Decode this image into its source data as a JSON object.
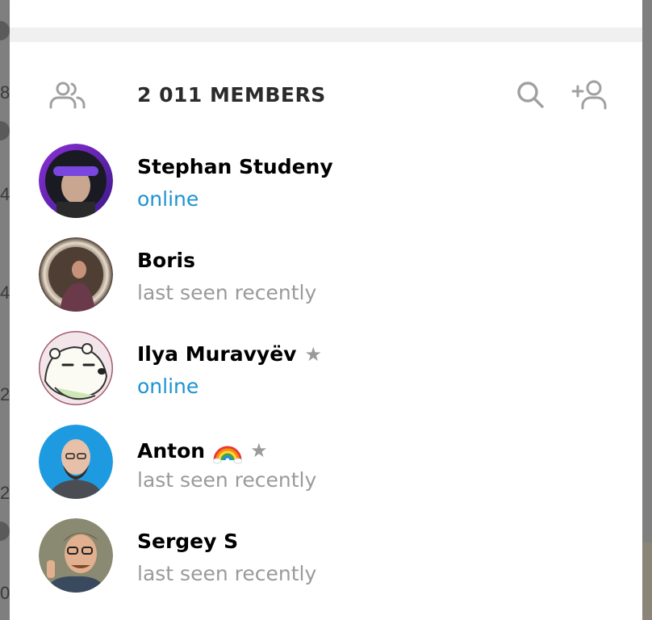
{
  "background": {
    "fragments": [
      "8",
      "4",
      "4",
      "2",
      "2",
      "0"
    ]
  },
  "header": {
    "members_count": "2 011 MEMBERS",
    "left_icon": "group-icon",
    "search_icon": "search-icon",
    "add_icon": "add-member-icon"
  },
  "members": [
    {
      "name": "Stephan Studeny",
      "status": "online",
      "online": true,
      "admin": false,
      "emoji": ""
    },
    {
      "name": "Boris",
      "status": "last seen recently",
      "online": false,
      "admin": false,
      "emoji": ""
    },
    {
      "name": "Ilya Muravyëv",
      "status": "online",
      "online": true,
      "admin": true,
      "emoji": ""
    },
    {
      "name": "Anton",
      "status": "last seen recently",
      "online": false,
      "admin": true,
      "emoji": "rainbow"
    },
    {
      "name": "Sergey S",
      "status": "last seen recently",
      "online": false,
      "admin": false,
      "emoji": ""
    }
  ],
  "colors": {
    "online": "#1c93d1",
    "muted": "#9a9a9a",
    "icon": "#a0a0a0"
  }
}
